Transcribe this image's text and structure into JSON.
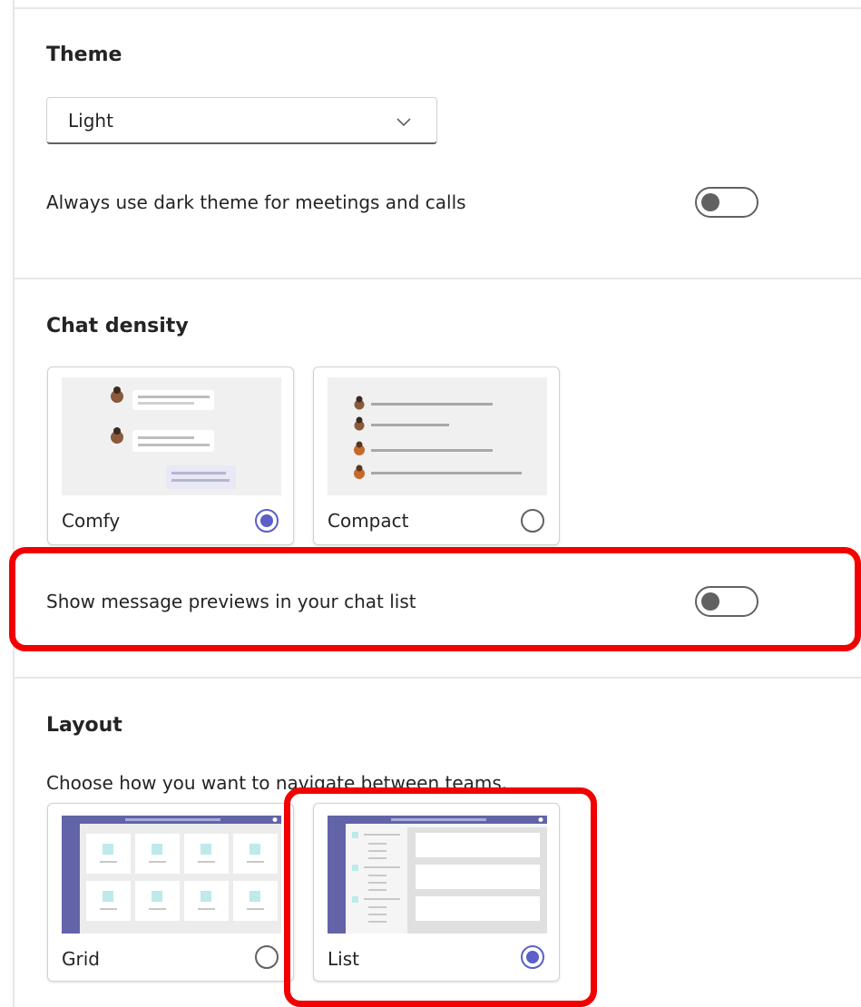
{
  "theme": {
    "heading": "Theme",
    "dropdown_value": "Light",
    "dark_meetings_label": "Always use dark theme for meetings and calls",
    "dark_meetings_on": false
  },
  "chat_density": {
    "heading": "Chat density",
    "options": [
      {
        "label": "Comfy",
        "selected": true
      },
      {
        "label": "Compact",
        "selected": false
      }
    ],
    "previews_label": "Show message previews in your chat list",
    "previews_on": false
  },
  "layout": {
    "heading": "Layout",
    "description": "Choose how you want to navigate between teams.",
    "options": [
      {
        "label": "Grid",
        "selected": false
      },
      {
        "label": "List",
        "selected": true
      }
    ]
  },
  "colors": {
    "accent": "#5b5fc7",
    "highlight": "#f20000",
    "sidebar": "#6264a7"
  },
  "icons": {
    "dropdown": "chevron-down-icon",
    "avatar": "avatar-icon"
  }
}
